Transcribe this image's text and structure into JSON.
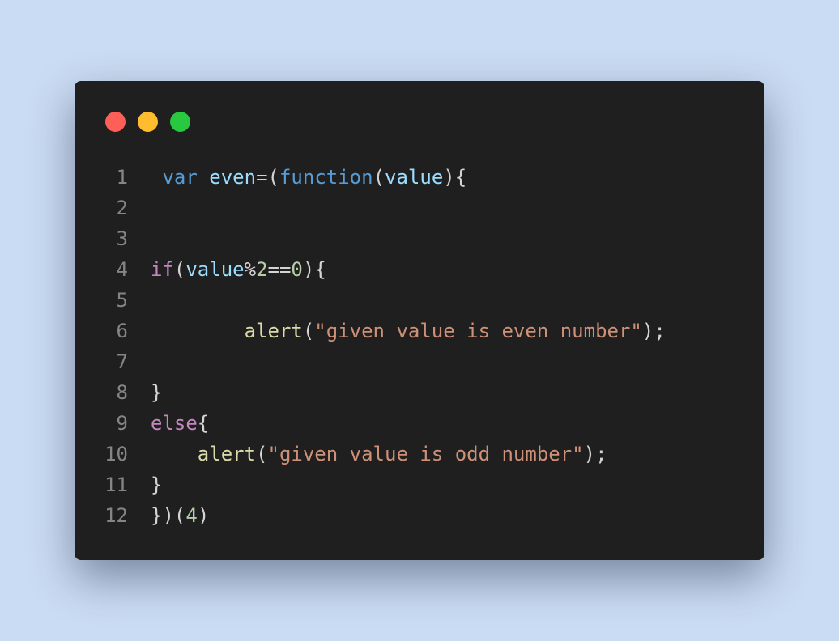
{
  "window": {
    "controls": [
      {
        "name": "close",
        "color": "#ff5f57"
      },
      {
        "name": "minimize",
        "color": "#febc2e"
      },
      {
        "name": "maximize",
        "color": "#28c840"
      }
    ]
  },
  "colors": {
    "background": "#cadcf3",
    "editor": "#1f1f1f",
    "line_number": "#858585",
    "keyword_blue": "#569cd6",
    "identifier": "#9cdcfe",
    "control_keyword": "#c586c0",
    "number": "#b5cea8",
    "function_call": "#dcdcaa",
    "string": "#ce9178",
    "punctuation": "#d4d4d4"
  },
  "code": {
    "lines": [
      {
        "num": "1",
        "tokens": [
          {
            "t": " "
          },
          {
            "t": "var",
            "c": "keyword_blue"
          },
          {
            "t": " "
          },
          {
            "t": "even",
            "c": "identifier"
          },
          {
            "t": "=("
          },
          {
            "t": "function",
            "c": "keyword_blue"
          },
          {
            "t": "("
          },
          {
            "t": "value",
            "c": "identifier"
          },
          {
            "t": "){"
          }
        ]
      },
      {
        "num": "2",
        "tokens": []
      },
      {
        "num": "3",
        "tokens": []
      },
      {
        "num": "4",
        "tokens": [
          {
            "t": "if",
            "c": "control_keyword"
          },
          {
            "t": "("
          },
          {
            "t": "value",
            "c": "identifier"
          },
          {
            "t": "%"
          },
          {
            "t": "2",
            "c": "number"
          },
          {
            "t": "=="
          },
          {
            "t": "0",
            "c": "number"
          },
          {
            "t": "){"
          }
        ]
      },
      {
        "num": "5",
        "tokens": []
      },
      {
        "num": "6",
        "tokens": [
          {
            "t": "        "
          },
          {
            "t": "alert",
            "c": "function_call"
          },
          {
            "t": "("
          },
          {
            "t": "\"given value is even number\"",
            "c": "string"
          },
          {
            "t": ");"
          }
        ]
      },
      {
        "num": "7",
        "tokens": []
      },
      {
        "num": "8",
        "tokens": [
          {
            "t": "}"
          }
        ]
      },
      {
        "num": "9",
        "tokens": [
          {
            "t": "else",
            "c": "control_keyword"
          },
          {
            "t": "{"
          }
        ]
      },
      {
        "num": "10",
        "tokens": [
          {
            "t": "    "
          },
          {
            "t": "alert",
            "c": "function_call"
          },
          {
            "t": "("
          },
          {
            "t": "\"given value is odd number\"",
            "c": "string"
          },
          {
            "t": ");"
          }
        ]
      },
      {
        "num": "11",
        "tokens": [
          {
            "t": "}"
          }
        ]
      },
      {
        "num": "12",
        "tokens": [
          {
            "t": "})("
          },
          {
            "t": "4",
            "c": "number"
          },
          {
            "t": ")"
          }
        ]
      }
    ]
  }
}
